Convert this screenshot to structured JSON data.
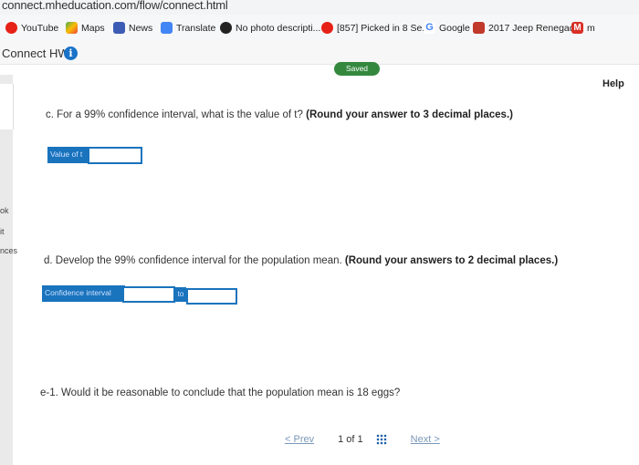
{
  "browser": {
    "url": "connect.mheducation.com/flow/connect.html",
    "bookmarks": [
      {
        "label": "YouTube",
        "icon": "youtube-icon",
        "color": "#e62117"
      },
      {
        "label": "Maps",
        "icon": "maps-icon",
        "color": "#4caf50"
      },
      {
        "label": "News",
        "icon": "news-icon",
        "color": "#3b5bb5"
      },
      {
        "label": "Translate",
        "icon": "translate-icon",
        "color": "#4285f4"
      },
      {
        "label": "No photo descripti...",
        "icon": "github-icon",
        "color": "#222222"
      },
      {
        "label": "[857] Picked in 8 Se...",
        "icon": "youtube-icon",
        "color": "#e62117"
      },
      {
        "label": "Google",
        "icon": "google-icon",
        "color": "#4285f4"
      },
      {
        "label": "2017 Jeep Renegad...",
        "icon": "car-icon",
        "color": "#c0392b"
      },
      {
        "label": "m",
        "icon": "gmail-icon",
        "color": "#d93025"
      }
    ]
  },
  "header": {
    "title": "Connect HW",
    "info_symbol": "i",
    "saved": "Saved",
    "help": "Help"
  },
  "left_edge": [
    "ok",
    "it",
    "nces"
  ],
  "questions": {
    "c": {
      "text": "c. For a 99% confidence interval, what is the value of t? ",
      "instruction": "(Round your answer to 3 decimal places.)",
      "label": "Value of t",
      "value": ""
    },
    "d": {
      "text": "d. Develop the 99% confidence interval for the population mean. ",
      "instruction": "(Round your answers to 2 decimal places.)",
      "label": "Confidence interval",
      "to_label": "to",
      "low": "",
      "high": ""
    },
    "e1": {
      "text": "e-1. Would it be reasonable to conclude that the population mean is 18 eggs?"
    }
  },
  "pager": {
    "prev": "< Prev",
    "current": "1",
    "of": "of",
    "total": "1",
    "next": "Next >"
  }
}
